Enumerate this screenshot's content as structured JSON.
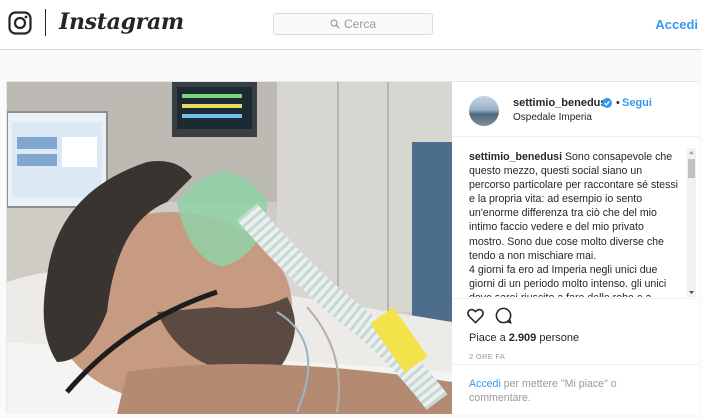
{
  "header": {
    "logo_text": "Instagram",
    "search_placeholder": "Cerca",
    "login_label": "Accedi"
  },
  "post": {
    "author": {
      "username": "settimio_benedusi",
      "verified": true,
      "follow_label": "Segui",
      "separator": "•",
      "location": "Ospedale Imperia"
    },
    "caption": {
      "username": "settimio_benedusi",
      "text_1": "Sono consapevole che questo mezzo, questi social siano un percorso particolare per raccontare sé stessi e la propria vita: ad esempio io sento un'enorme differenza tra ciò che del mio intimo faccio vedere e del mio privato mostro. Sono due cose molto diverse che tendo a non mischiare mai.",
      "text_2": "4 giorni fa ero ad Imperia negli unici due giorni di un periodo molto intenso. gli unici dove sarei riuscito a fare delle robe e a"
    },
    "likes_prefix": "Piace a",
    "likes_count": "2.909",
    "likes_suffix": "persone",
    "time_ago": "2 ORE FA",
    "comment_login_label": "Accedi",
    "comment_prompt": "per mettere \"Mi piace\" o commentare.",
    "colors": {
      "accent": "#3897f0",
      "text": "#262626",
      "muted": "#999999",
      "border": "#dbdbdb"
    },
    "icons": [
      "heart-icon",
      "comment-icon",
      "verified-badge-icon",
      "search-icon",
      "instagram-camera-icon"
    ]
  }
}
